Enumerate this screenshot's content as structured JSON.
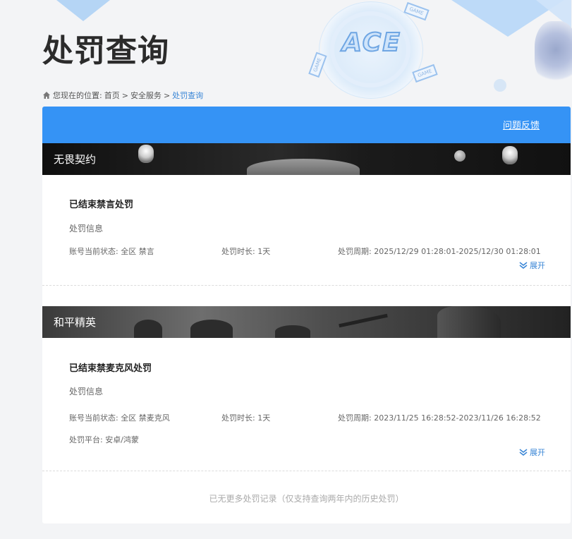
{
  "page": {
    "title": "处罚查询"
  },
  "breadcrumb": {
    "prefix": "您现在的位置:",
    "items": [
      "首页",
      "安全服务",
      "处罚查询"
    ],
    "separator": ">"
  },
  "header": {
    "feedback_link": "问题反馈",
    "accent_color": "#3593f5"
  },
  "records": [
    {
      "game": "无畏契约",
      "title": "已结束禁言处罚",
      "section": "处罚信息",
      "status_label": "账号当前状态:",
      "status_value": "全区 禁言",
      "duration_label": "处罚时长:",
      "duration_value": "1天",
      "period_label": "处罚周期:",
      "period_value": "2025/12/29 01:28:01-2025/12/30 01:28:01",
      "expand_label": "展开"
    },
    {
      "game": "和平精英",
      "title": "已结束禁麦克风处罚",
      "section": "处罚信息",
      "status_label": "账号当前状态:",
      "status_value": "全区 禁麦克风",
      "duration_label": "处罚时长:",
      "duration_value": "1天",
      "period_label": "处罚周期:",
      "period_value": "2023/11/25 16:28:52-2023/11/26 16:28:52",
      "platform_label": "处罚平台:",
      "platform_value": "安卓/鸿蒙",
      "expand_label": "展开"
    }
  ],
  "footer": {
    "note": "已无更多处罚记录（仅支持查询两年内的历史处罚）"
  },
  "decor": {
    "logo_text": "ACE",
    "game_tag": "GAME"
  }
}
